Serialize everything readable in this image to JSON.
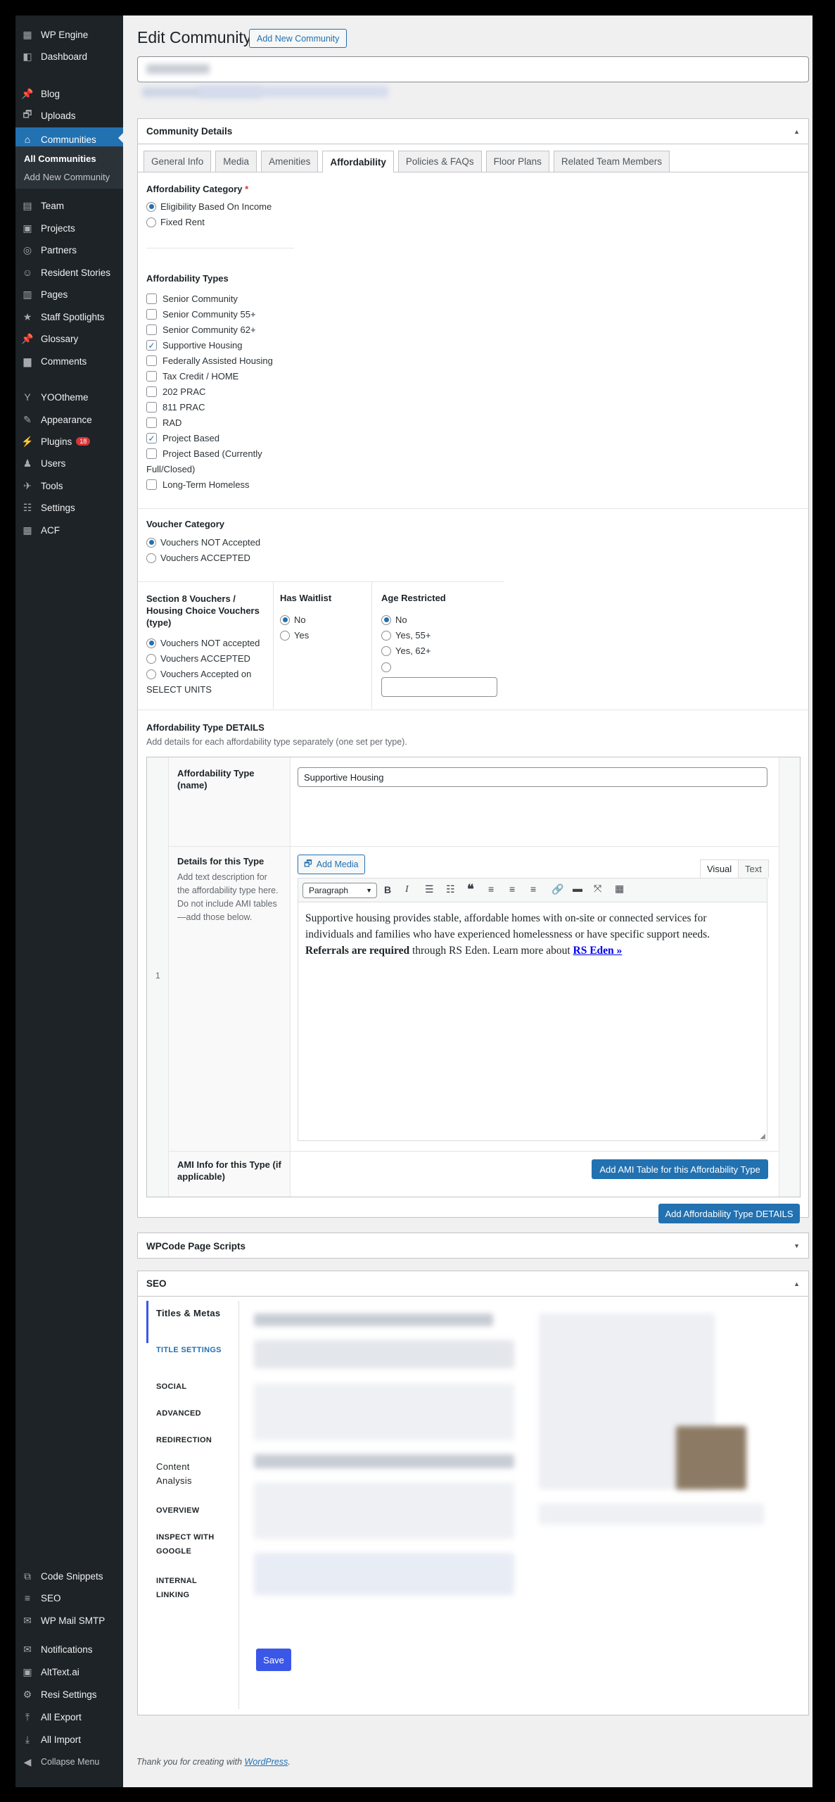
{
  "sidebar": {
    "items": [
      {
        "label": "WP Engine",
        "icon": "wpengine-icon"
      },
      {
        "label": "Dashboard",
        "icon": "dashboard-icon"
      },
      {
        "label": "Blog",
        "icon": "pin-icon"
      },
      {
        "label": "Uploads",
        "icon": "media-icon"
      },
      {
        "label": "Communities",
        "icon": "communities-icon"
      },
      {
        "label": "Team",
        "icon": "id-card-icon"
      },
      {
        "label": "Projects",
        "icon": "portfolio-icon"
      },
      {
        "label": "Partners",
        "icon": "partners-icon"
      },
      {
        "label": "Resident Stories",
        "icon": "smile-icon"
      },
      {
        "label": "Pages",
        "icon": "pages-icon"
      },
      {
        "label": "Staff Spotlights",
        "icon": "star-icon"
      },
      {
        "label": "Glossary",
        "icon": "pin-icon"
      },
      {
        "label": "Comments",
        "icon": "comments-icon"
      },
      {
        "label": "YOOtheme",
        "icon": "yootheme-icon"
      },
      {
        "label": "Appearance",
        "icon": "brush-icon"
      },
      {
        "label": "Plugins",
        "icon": "plugin-icon",
        "badge": "18"
      },
      {
        "label": "Users",
        "icon": "users-icon"
      },
      {
        "label": "Tools",
        "icon": "wrench-icon"
      },
      {
        "label": "Settings",
        "icon": "settings-icon"
      },
      {
        "label": "ACF",
        "icon": "acf-icon"
      }
    ],
    "sub": [
      "All Communities",
      "Add New Community"
    ],
    "bottom": [
      {
        "label": "Code Snippets",
        "icon": "code-icon"
      },
      {
        "label": "SEO",
        "icon": "seo-icon"
      },
      {
        "label": "WP Mail SMTP",
        "icon": "mail-icon"
      },
      {
        "label": "Notifications",
        "icon": "envelope-icon"
      },
      {
        "label": "AltText.ai",
        "icon": "alttext-icon"
      },
      {
        "label": "Resi Settings",
        "icon": "gear-icon"
      },
      {
        "label": "All Export",
        "icon": "export-icon"
      },
      {
        "label": "All Import",
        "icon": "import-icon"
      },
      {
        "label": "Collapse Menu",
        "icon": "collapse-icon"
      }
    ]
  },
  "header": {
    "title": "Edit Community",
    "add_new": "Add New Community"
  },
  "details": {
    "title": "Community Details",
    "tabs": [
      "General Info",
      "Media",
      "Amenities",
      "Affordability",
      "Policies & FAQs",
      "Floor Plans",
      "Related Team Members"
    ],
    "aff_category": {
      "label": "Affordability Category",
      "required": "*",
      "options": [
        "Eligibility Based On Income",
        "Fixed Rent"
      ]
    },
    "aff_types": {
      "label": "Affordability Types",
      "options": [
        "Senior Community",
        "Senior Community 55+",
        "Senior Community 62+",
        "Supportive Housing",
        "Federally Assisted Housing",
        "Tax Credit / HOME",
        "202 PRAC",
        "811 PRAC",
        "RAD",
        "Project Based",
        "Project Based (Currently",
        "Full/Closed)",
        "Long-Term Homeless"
      ]
    },
    "voucher": {
      "label": "Voucher Category",
      "options": [
        "Vouchers NOT Accepted",
        "Vouchers ACCEPTED"
      ]
    },
    "section8": {
      "label": "Section 8 Vouchers / Housing Choice Vouchers (type)",
      "options": [
        "Vouchers NOT accepted",
        "Vouchers ACCEPTED",
        "Vouchers Accepted on"
      ],
      "extra": "SELECT UNITS"
    },
    "waitlist": {
      "label": "Has Waitlist",
      "options": [
        "No",
        "Yes"
      ]
    },
    "age": {
      "label": "Age Restricted",
      "options": [
        "No",
        "Yes, 55+",
        "Yes, 62+"
      ]
    },
    "type_details": {
      "label": "Affordability Type DETAILS",
      "desc": "Add details for each affordability type separately (one set per type).",
      "row_num": "1",
      "name_label": "Affordability Type (name)",
      "name_value": "Supportive Housing",
      "details_label": "Details for this Type",
      "details_desc": "Add text description for the affordability type here. Do not include AMI tables—add those below.",
      "add_media": "Add Media",
      "visual": "Visual",
      "text": "Text",
      "format": "Paragraph",
      "content_p1": "Supportive housing provides stable, affordable homes with on-site or connected services for individuals and families who have experienced homelessness or have specific support needs.",
      "content_bold": "Referrals are required",
      "content_p2": " through RS Eden.  Learn more about ",
      "content_link": "RS Eden »",
      "ami_label": "AMI Info for this Type (if applicable)",
      "ami_button": "Add AMI Table for this Affordability Type",
      "add_details_button": "Add Affordability Type DETAILS"
    }
  },
  "wpcode": {
    "title": "WPCode Page Scripts"
  },
  "seo": {
    "title": "SEO",
    "nav": [
      "Titles & Metas",
      "TITLE SETTINGS",
      "SOCIAL",
      "ADVANCED",
      "REDIRECTION",
      "Content Analysis",
      "OVERVIEW",
      "INSPECT WITH GOOGLE",
      "INTERNAL LINKING"
    ],
    "save": "Save"
  },
  "footer": {
    "text": "Thank you for creating with ",
    "link": "WordPress",
    "end": "."
  }
}
